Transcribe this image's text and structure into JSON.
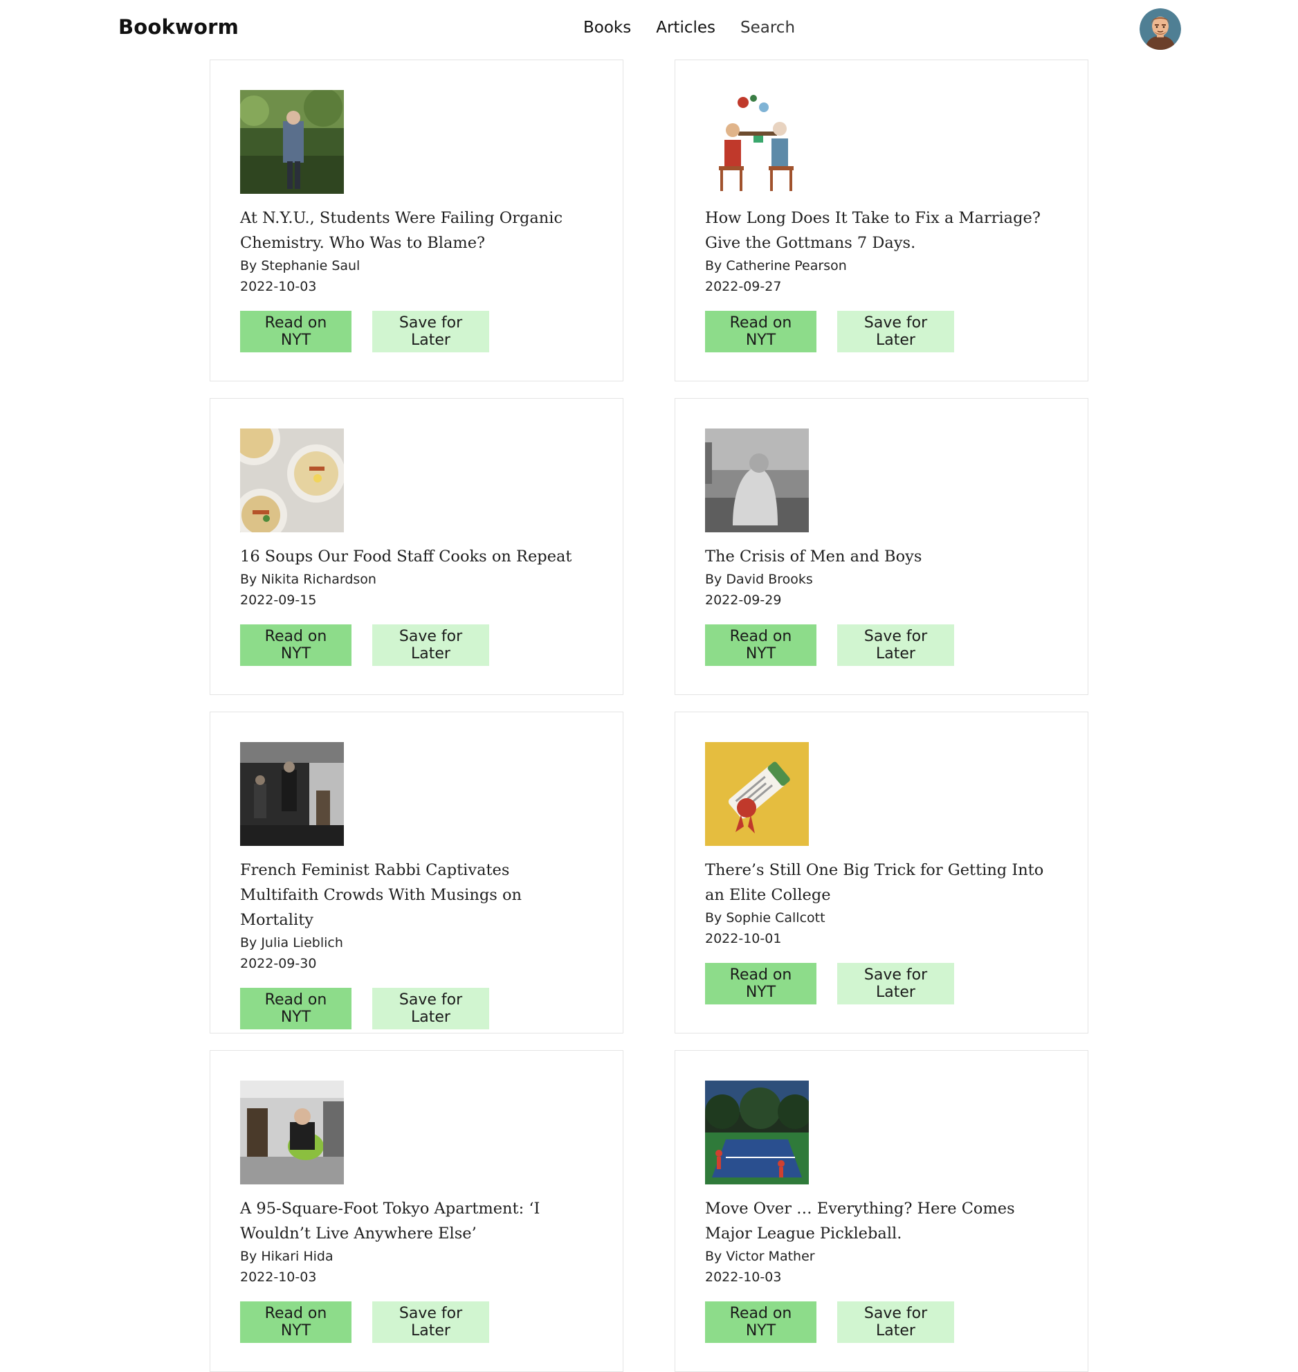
{
  "header": {
    "brand": "Bookworm",
    "nav": [
      {
        "label": "Books"
      },
      {
        "label": "Articles"
      },
      {
        "label": "Search"
      }
    ]
  },
  "articles": [
    {
      "title": "At N.Y.U., Students Were Failing Organic Chemistry. Who Was to Blame?",
      "author": "By Stephanie Saul",
      "date": "2022-10-03",
      "read_label": "Read on NYT",
      "save_label": "Save for Later"
    },
    {
      "title": "How Long Does It Take to Fix a Marriage? Give the Gottmans 7 Days.",
      "author": "By Catherine Pearson",
      "date": "2022-09-27",
      "read_label": "Read on NYT",
      "save_label": "Save for Later"
    },
    {
      "title": "16 Soups Our Food Staff Cooks on Repeat",
      "author": "By Nikita Richardson",
      "date": "2022-09-15",
      "read_label": "Read on NYT",
      "save_label": "Save for Later"
    },
    {
      "title": "The Crisis of Men and Boys",
      "author": "By David Brooks",
      "date": "2022-09-29",
      "read_label": "Read on NYT",
      "save_label": "Save for Later"
    },
    {
      "title": "French Feminist Rabbi Captivates Multifaith Crowds With Musings on Mortality",
      "author": "By Julia Lieblich",
      "date": "2022-09-30",
      "read_label": "Read on NYT",
      "save_label": "Save for Later"
    },
    {
      "title": "There’s Still One Big Trick for Getting Into an Elite College",
      "author": "By Sophie Callcott",
      "date": "2022-10-01",
      "read_label": "Read on NYT",
      "save_label": "Save for Later"
    },
    {
      "title": "A 95-Square-Foot Tokyo Apartment: ‘I Wouldn’t Live Anywhere Else’",
      "author": "By Hikari Hida",
      "date": "2022-10-03",
      "read_label": "Read on NYT",
      "save_label": "Save for Later"
    },
    {
      "title": "Move Over … Everything? Here Comes Major League Pickleball.",
      "author": "By Victor Mather",
      "date": "2022-10-03",
      "read_label": "Read on NYT",
      "save_label": "Save for Later"
    }
  ]
}
